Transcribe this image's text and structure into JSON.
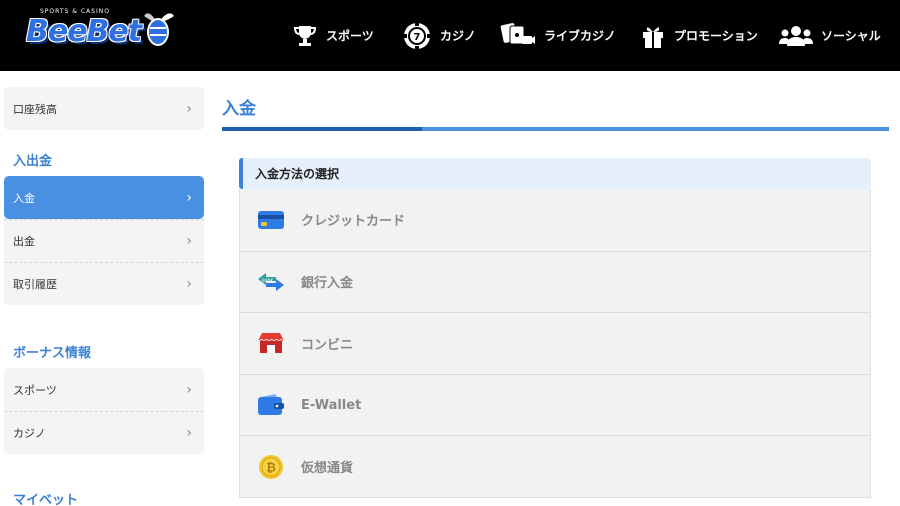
{
  "header": {
    "logo_text": "BeeBet",
    "logo_sub": "SPORTS & CASINO",
    "nav": [
      {
        "label": "スポーツ",
        "icon": "trophy-icon"
      },
      {
        "label": "カジノ",
        "icon": "casino-chip-icon"
      },
      {
        "label": "ライブカジノ",
        "icon": "live-casino-icon"
      },
      {
        "label": "プロモーション",
        "icon": "gift-icon"
      },
      {
        "label": "ソーシャル",
        "icon": "users-icon"
      }
    ]
  },
  "sidebar": {
    "top_item": {
      "label": "口座残高"
    },
    "sections": [
      {
        "heading": "入出金",
        "items": [
          {
            "label": "入金",
            "active": true
          },
          {
            "label": "出金",
            "active": false
          },
          {
            "label": "取引履歴",
            "active": false
          }
        ]
      },
      {
        "heading": "ボーナス情報",
        "items": [
          {
            "label": "スポーツ",
            "active": false
          },
          {
            "label": "カジノ",
            "active": false
          }
        ]
      },
      {
        "heading": "マイベット",
        "items": []
      }
    ]
  },
  "main": {
    "title": "入金",
    "panel_heading": "入金方法の選択",
    "methods": [
      {
        "label": "クレジットカード",
        "icon": "credit-card-icon"
      },
      {
        "label": "銀行入金",
        "icon": "bank-transfer-icon"
      },
      {
        "label": "コンビニ",
        "icon": "convenience-store-icon"
      },
      {
        "label": "E-Wallet",
        "icon": "wallet-icon"
      },
      {
        "label": "仮想通貨",
        "icon": "crypto-coin-icon"
      }
    ]
  },
  "colors": {
    "accent": "#3b82d6",
    "active_bg": "#4a90e2",
    "header_bg": "#000000"
  }
}
